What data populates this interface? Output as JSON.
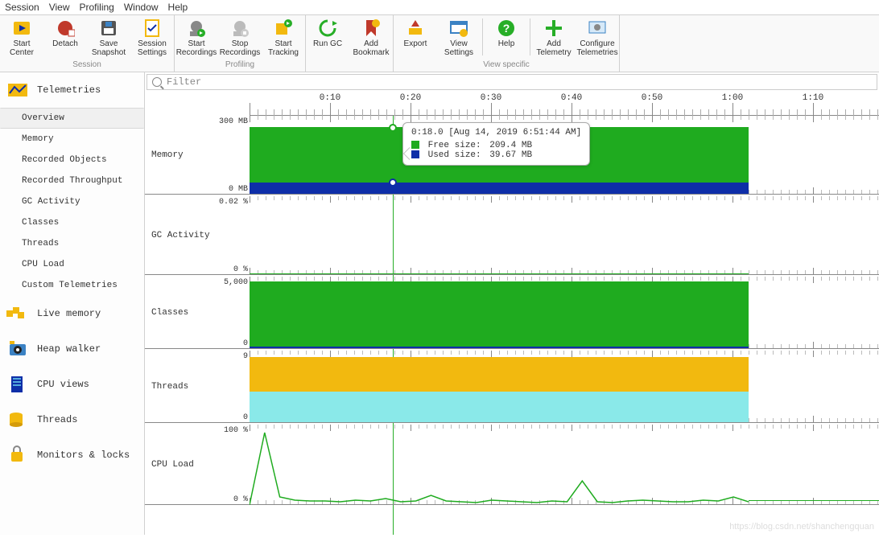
{
  "menubar": [
    "Session",
    "View",
    "Profiling",
    "Window",
    "Help"
  ],
  "toolbar": {
    "groups": [
      {
        "label": "Session",
        "buttons": [
          "Start\nCenter",
          "Detach",
          "Save\nSnapshot",
          "Session\nSettings"
        ]
      },
      {
        "label": "Profiling",
        "buttons": [
          "Start\nRecordings",
          "Stop\nRecordings",
          "Start\nTracking"
        ]
      },
      {
        "label": "",
        "buttons": [
          "Run GC",
          "Add\nBookmark"
        ]
      },
      {
        "label": "View specific",
        "buttons": [
          "Export",
          "View\nSettings",
          "Help",
          "Add\nTelemetry",
          "Configure\nTelemetries"
        ]
      }
    ]
  },
  "filter": {
    "placeholder": "Filter"
  },
  "sidebar": {
    "sections": [
      {
        "title": "Telemetries",
        "items": [
          "Overview",
          "Memory",
          "Recorded Objects",
          "Recorded Throughput",
          "GC Activity",
          "Classes",
          "Threads",
          "CPU Load",
          "Custom Telemetries"
        ],
        "selected": 0
      },
      {
        "title": "Live memory"
      },
      {
        "title": "Heap walker"
      },
      {
        "title": "CPU views"
      },
      {
        "title": "Threads"
      },
      {
        "title": "Monitors & locks"
      }
    ]
  },
  "timeline": {
    "labels": [
      "0:10",
      "0:20",
      "0:30",
      "0:40",
      "0:50",
      "1:00",
      "1:10"
    ]
  },
  "tooltip": {
    "time": "0:18.0 [Aug 14, 2019 6:51:44 AM]",
    "rows": [
      {
        "color": "#1fab1f",
        "label": "Free size:",
        "value": "209.4 MB"
      },
      {
        "color": "#0e2ea8",
        "label": "Used size:",
        "value": "39.67 MB"
      }
    ]
  },
  "charts": {
    "memory": {
      "label": "Memory",
      "ytop": "300 MB",
      "ybot": "0 MB"
    },
    "gc": {
      "label": "GC Activity",
      "ytop": "0.02 %",
      "ybot": "0 %"
    },
    "classes": {
      "label": "Classes",
      "ytop": "5,000",
      "ybot": "0"
    },
    "threads": {
      "label": "Threads",
      "ytop": "9",
      "ybot": "0"
    },
    "cpu": {
      "label": "CPU Load",
      "ytop": "100 %",
      "ybot": "0 %"
    }
  },
  "colors": {
    "green": "#1fab1f",
    "darkgreen": "#148a14",
    "blue": "#0e2ea8",
    "orange": "#f2b90f",
    "cyan": "#8ae9e9"
  },
  "chart_data": {
    "type": "area",
    "x_unit": "seconds",
    "x_range": [
      0,
      80
    ],
    "vline_x": 18,
    "series": {
      "memory": {
        "type": "stacked-area",
        "data_at_vline": {
          "free_mb": 209.4,
          "used_mb": 39.67
        },
        "ylim": [
          0,
          300
        ]
      },
      "gc_activity_pct": {
        "type": "line",
        "ylim": [
          0,
          0.02
        ],
        "values_near_zero": true
      },
      "classes": {
        "type": "area",
        "ylim": [
          0,
          5000
        ],
        "approx_value": 4800
      },
      "threads": {
        "type": "stacked-area",
        "ylim": [
          0,
          9
        ],
        "orange_approx": 4.5,
        "cyan_approx": 4.5
      },
      "cpu_load_pct": {
        "type": "line",
        "ylim": [
          0,
          100
        ],
        "samples": [
          0,
          90,
          10,
          6,
          5,
          5,
          4,
          6,
          5,
          8,
          4,
          5,
          12,
          5,
          4,
          3,
          6,
          5,
          4,
          3,
          5,
          4,
          30,
          4,
          3,
          5,
          6,
          5,
          4,
          4,
          6,
          5,
          10,
          4
        ]
      }
    }
  },
  "watermark": "https://blog.csdn.net/shanchengquan"
}
